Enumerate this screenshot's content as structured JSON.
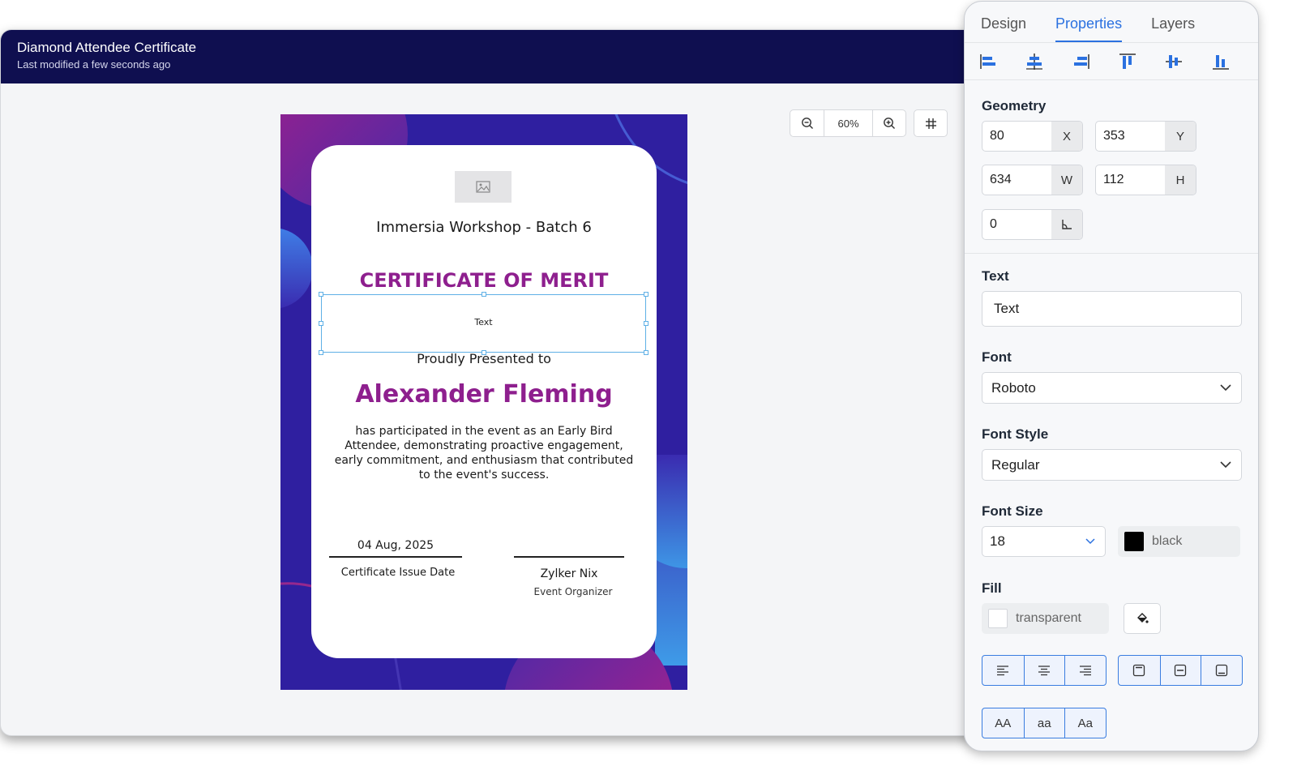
{
  "header": {
    "title": "Diamond Attendee Certificate",
    "subtitle": "Last modified a few seconds ago"
  },
  "canvas_toolbar": {
    "zoom_value": "60%",
    "zoom_out_icon": "zoom-out-icon",
    "zoom_in_icon": "zoom-in-icon",
    "grid_icon": "grid-icon"
  },
  "certificate": {
    "event_name": "Immersia Workshop - Batch 6",
    "heading": "CERTIFICATE OF MERIT",
    "selected_text": "Text",
    "presented_to": "Proudly Presented to",
    "recipient": "Alexander Fleming",
    "body_lines": [
      "has participated in the event as an Early Bird",
      "Attendee, demonstrating proactive engagement,",
      "early commitment, and enthusiasm that contributed",
      "to the event's success."
    ],
    "issue_date": "04 Aug, 2025",
    "issue_date_label": "Certificate Issue Date",
    "organizer_name": "Zylker Nix",
    "organizer_role": "Event Organizer",
    "colors": {
      "frame": "#2f1fa0",
      "accent": "#8e1f8e",
      "magenta": "#9b1e84",
      "blue": "#3b7ee8"
    }
  },
  "panel": {
    "tabs": [
      {
        "label": "Design",
        "active": false
      },
      {
        "label": "Properties",
        "active": true
      },
      {
        "label": "Layers",
        "active": false
      }
    ],
    "align_icons": [
      "align-left-icon",
      "align-center-horizontal-icon",
      "align-right-icon",
      "align-top-icon",
      "align-middle-vertical-icon",
      "align-bottom-icon"
    ],
    "geometry": {
      "label": "Geometry",
      "x": {
        "value": "80",
        "unit": "X"
      },
      "y": {
        "value": "353",
        "unit": "Y"
      },
      "w": {
        "value": "634",
        "unit": "W"
      },
      "h": {
        "value": "112",
        "unit": "H"
      },
      "rotation": {
        "value": "0",
        "icon": "angle-icon"
      }
    },
    "text": {
      "label": "Text",
      "value": "Text"
    },
    "font": {
      "label": "Font",
      "value": "Roboto"
    },
    "font_style": {
      "label": "Font Style",
      "value": "Regular"
    },
    "font_size": {
      "label": "Font Size",
      "value": "18",
      "color_name": "black",
      "color": "#000000"
    },
    "fill": {
      "label": "Fill",
      "value": "transparent",
      "bucket_icon": "paint-bucket-icon"
    },
    "text_align_icons": [
      "text-align-left-icon",
      "text-align-center-icon",
      "text-align-right-icon"
    ],
    "vertical_align_icons": [
      "vertical-align-top-icon",
      "vertical-align-middle-icon",
      "vertical-align-bottom-icon"
    ],
    "case": [
      "AA",
      "aa",
      "Aa"
    ],
    "accent": "#2b71e0"
  }
}
